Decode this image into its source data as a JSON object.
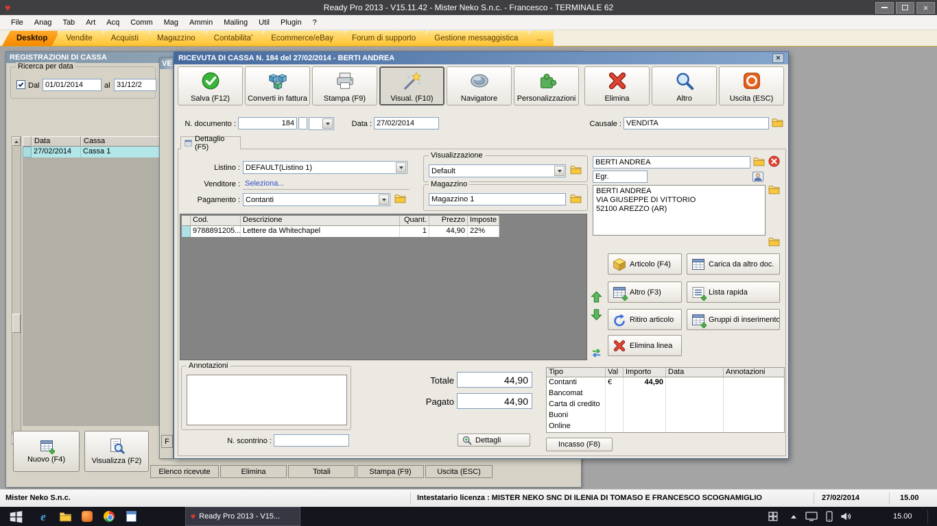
{
  "colors": {
    "tab_orange": "#f78900",
    "dialog_titlebar_blue": "#44699e",
    "selected_row_cyan": "#b2e6e8",
    "save_green": "#3cb43c",
    "delete_red": "#e04433",
    "taskbar_dark": "#15151d"
  },
  "titlebar": {
    "title": "Ready Pro 2013 - V15.11.42 - Mister Neko S.n.c. - Francesco - TERMINALE 62"
  },
  "menubar": {
    "items": [
      "File",
      "Anag",
      "Tab",
      "Art",
      "Acq",
      "Comm",
      "Mag",
      "Ammin",
      "Mailing",
      "Util",
      "Plugin",
      "?"
    ]
  },
  "tabbar": {
    "items": [
      "Desktop",
      "Vendite",
      "Acquisti",
      "Magazzino",
      "Contabilita'",
      "Ecommerce/eBay",
      "Forum di supporto",
      "Gestione messaggistica",
      "..."
    ]
  },
  "cash_window": {
    "title": "REGISTRAZIONI DI CASSA",
    "search_group_label": "Ricerca per data",
    "dal_label": "Dal",
    "dal_value": "01/01/2014",
    "al_label": "al",
    "al_value": "31/12/2",
    "table": {
      "columns": [
        "Data",
        "Cassa"
      ],
      "row": [
        "27/02/2014",
        "Cassa 1"
      ]
    },
    "nuovo_button": "Nuovo (F4)",
    "visualizza_button": "Visualizza (F2)",
    "bottom_buttons": [
      "Elenco ricevute",
      "Elimina",
      "Totali",
      "Stampa (F9)",
      "Uscita (ESC)"
    ]
  },
  "back_window": {
    "title": "VE",
    "button": "F"
  },
  "receipt_dialog": {
    "title": "RICEVUTA DI CASSA N. 184 del 27/02/2014 - BERTI ANDREA",
    "toolbar": [
      {
        "label": "Salva (F12)",
        "icon": "save-check-icon"
      },
      {
        "label": "Converti in fattura",
        "icon": "convert-cubes-icon"
      },
      {
        "label": "Stampa (F9)",
        "icon": "printer-icon"
      },
      {
        "label": "Visual. (F10)",
        "icon": "magic-wand-icon",
        "pressed": true
      },
      {
        "label": "Navigatore",
        "icon": "navigator-globe-icon"
      },
      {
        "label": "Personalizzazioni",
        "icon": "puzzle-icon"
      },
      {
        "label": "Elimina",
        "icon": "delete-x-icon"
      },
      {
        "label": "Altro",
        "icon": "magnifier-icon"
      },
      {
        "label": "Uscita (ESC)",
        "icon": "exit-icon"
      }
    ],
    "header_fields": {
      "n_documento_label": "N. documento :",
      "n_documento_value": "184",
      "data_label": "Data :",
      "data_value": "27/02/2014",
      "causale_label": "Causale :",
      "causale_value": "VENDITA"
    },
    "detail_tab_label": "Dettaglio (F5)",
    "left_fields": {
      "listino_label": "Listino :",
      "listino_value": "DEFAULT(Listino 1)",
      "venditore_label": "Venditore :",
      "venditore_value": "Seleziona...",
      "pagamento_label": "Pagamento :",
      "pagamento_value": "Contanti"
    },
    "visualizzazione_group": {
      "label": "Visualizzazione",
      "value": "Default"
    },
    "magazzino_group": {
      "label": "Magazzino",
      "value": "Magazzino 1"
    },
    "customer": {
      "name": "BERTI ANDREA",
      "title_value": "Egr.",
      "address_line1": "BERTI ANDREA",
      "address_line2": "VIA GIUSEPPE DI VITTORIO",
      "address_line3": "52100 AREZZO (AR)"
    },
    "items_table": {
      "columns": [
        "Cod.",
        "Descrizione",
        "Quant.",
        "Prezzo",
        "Imposte"
      ],
      "row": {
        "cod": "9788891205...",
        "descrizione": "Lettere da Whitechapel",
        "quant": "1",
        "prezzo": "44,90",
        "imposte": "22%"
      }
    },
    "side_buttons": {
      "articolo": "Articolo (F4)",
      "carica": "Carica da altro doc.",
      "altro": "Altro (F3)",
      "lista": "Lista rapida",
      "ritiro": "Ritiro articolo",
      "gruppi": "Gruppi di inserimento",
      "elimina_linea": "Elimina linea"
    },
    "annotazioni_label": "Annotazioni",
    "n_scontrino_label": "N. scontrino :",
    "totale_label": "Totale",
    "totale_value": "44,90",
    "pagato_label": "Pagato",
    "pagato_value": "44,90",
    "dettagli_button": "Dettagli",
    "payments_table": {
      "columns": [
        "Tipo",
        "Val",
        "Importo",
        "Data",
        "Annotazioni"
      ],
      "rows": [
        [
          "Contanti",
          "€",
          "44,90",
          "",
          ""
        ],
        [
          "Bancomat",
          "",
          "",
          "",
          ""
        ],
        [
          "Carta di credito",
          "",
          "",
          "",
          ""
        ],
        [
          "Buoni",
          "",
          "",
          "",
          ""
        ],
        [
          "Online",
          "",
          "",
          "",
          ""
        ]
      ]
    },
    "incasso_button": "Incasso (F8)"
  },
  "statusbar": {
    "company": "Mister Neko S.n.c.",
    "license": "Intestatario licenza : MISTER NEKO SNC DI ILENIA DI TOMASO E FRANCESCO SCOGNAMIGLIO",
    "date": "27/02/2014",
    "time": "15.00"
  },
  "taskbar": {
    "app_button": "Ready Pro 2013 - V15...",
    "time": "15.00"
  }
}
